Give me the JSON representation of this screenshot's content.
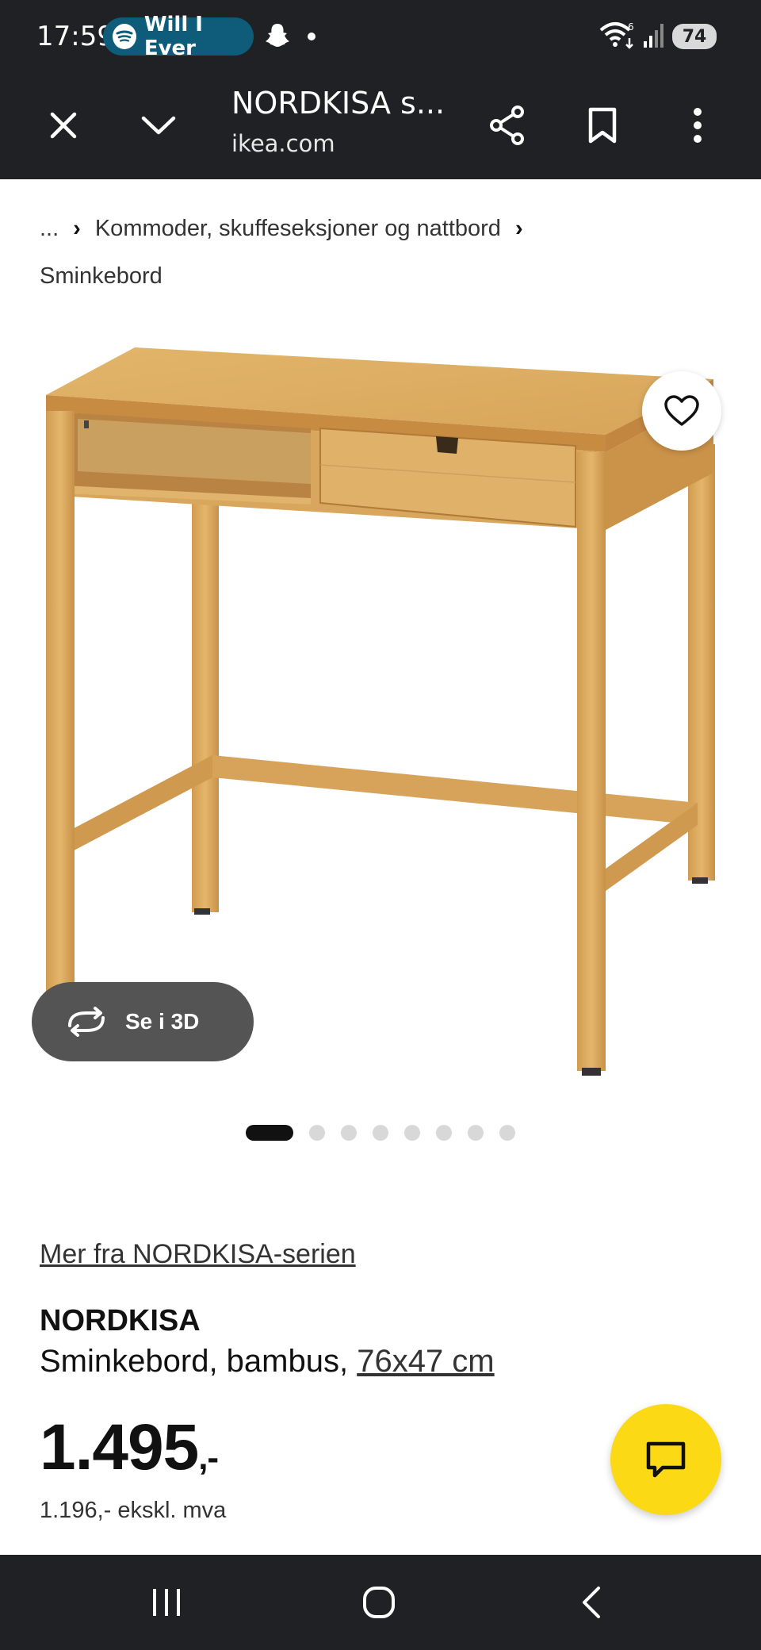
{
  "status_bar": {
    "time": "17:59",
    "media_label": "Will I Ever",
    "battery": "74"
  },
  "browser": {
    "title": "NORDKISA s...",
    "url": "ikea.com"
  },
  "breadcrumb": {
    "ellipsis": "...",
    "category": "Kommoder, skuffeseksjoner og nattbord",
    "current": "Sminkebord"
  },
  "gallery": {
    "view_3d_label": "Se i 3D",
    "image_count": 8,
    "active_index": 0
  },
  "product": {
    "series_link": "Mer fra NORDKISA-serien",
    "name": "NORDKISA",
    "description": "Sminkebord, bambus, ",
    "measurement": "76x47 cm",
    "price_main": "1.495",
    "price_suffix": ",-",
    "price_ex_vat": "1.196,- ekskl. mva"
  },
  "colors": {
    "system_bar": "#202124",
    "ikea_yellow": "#fbd914",
    "bamboo": "#d9a757"
  }
}
